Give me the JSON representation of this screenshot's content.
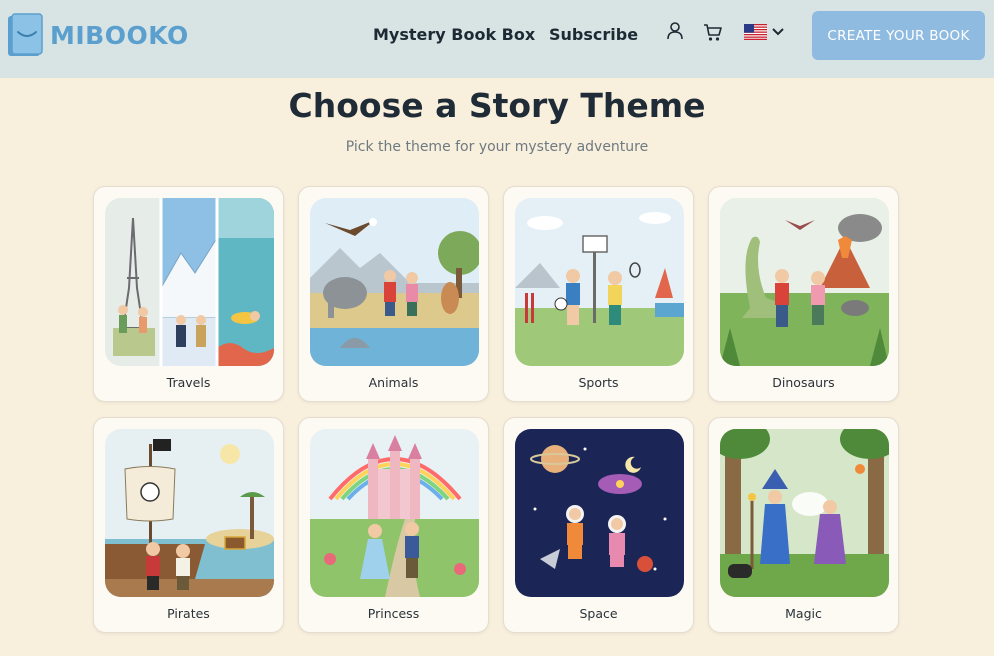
{
  "header": {
    "logo_text": "MIBOOKO",
    "nav": [
      {
        "label": "Mystery Book Box"
      },
      {
        "label": "Subscribe"
      }
    ],
    "icons": [
      "user-icon",
      "cart-icon",
      "us-flag-icon",
      "chevron-down-icon"
    ],
    "cta_label": "CREATE YOUR BOOK"
  },
  "main": {
    "title": "Choose a Story Theme",
    "subtitle": "Pick the theme for your mystery adventure",
    "themes": [
      {
        "label": "Travels"
      },
      {
        "label": "Animals"
      },
      {
        "label": "Sports"
      },
      {
        "label": "Dinosaurs"
      },
      {
        "label": "Pirates"
      },
      {
        "label": "Princess"
      },
      {
        "label": "Space"
      },
      {
        "label": "Magic"
      }
    ]
  },
  "colors": {
    "background": "#f8efdc",
    "header": "#d8e4e4",
    "brand": "#5b9fce",
    "cta": "#8fbbe0"
  }
}
